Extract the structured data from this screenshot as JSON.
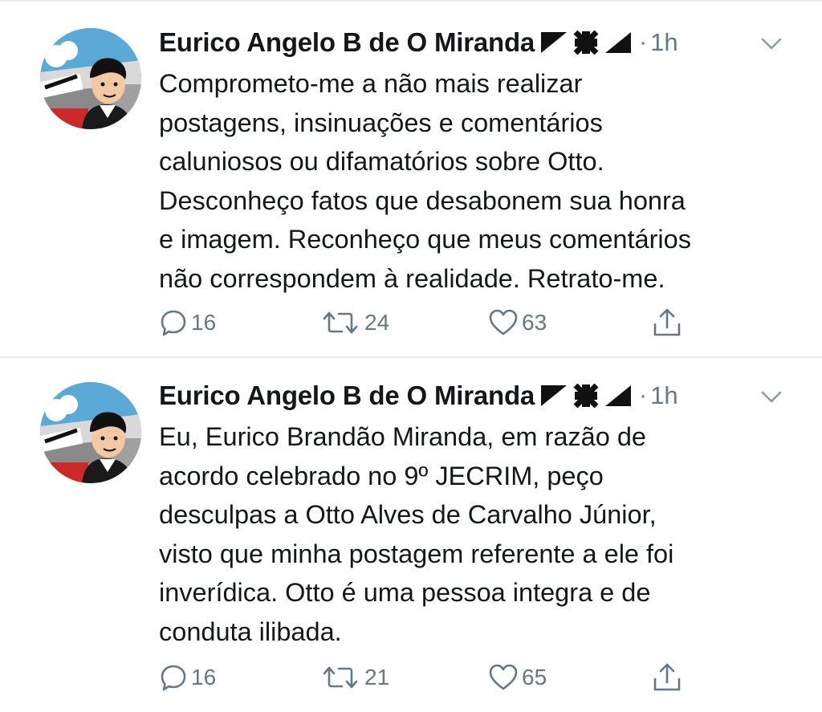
{
  "tweets": [
    {
      "author_name": "Eurico Angelo B de O Miranda",
      "separator": "·",
      "time": "1h",
      "text_lines": [
        "Comprometo-me a não mais realizar",
        "postagens, insinuações e comentários",
        "caluniosos ou difamatórios sobre Otto.",
        "Desconheço fatos que desabonem sua honra",
        "e imagem. Reconheço que meus comentários",
        "não correspondem à realidade. Retrato-me."
      ],
      "replies": "16",
      "retweets": "24",
      "likes": "63"
    },
    {
      "author_name": "Eurico Angelo B de O Miranda",
      "separator": "·",
      "time": "1h",
      "text_lines": [
        "Eu, Eurico Brandão Miranda, em razão de",
        "acordo celebrado no 9º JECRIM, peço",
        "desculpas a Otto Alves de Carvalho Júnior,",
        "visto que minha postagem referente a ele foi",
        "inverídica. Otto é uma pessoa integra e de",
        "conduta ilibada."
      ],
      "replies": "16",
      "retweets": "21",
      "likes": "65"
    }
  ],
  "icons": {
    "avatar": "cartoon-avatar",
    "flag": "vasco-flag-icon",
    "caret": "chevron-down-icon",
    "reply": "reply-icon",
    "retweet": "retweet-icon",
    "like": "heart-icon",
    "share": "share-icon"
  },
  "colors": {
    "text": "#14171a",
    "secondary": "#657786",
    "divider": "#e6ecf0"
  }
}
